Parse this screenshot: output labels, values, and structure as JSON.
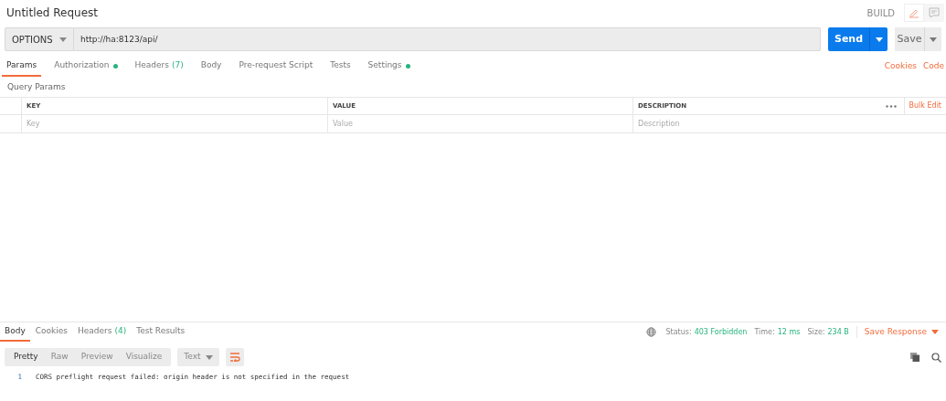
{
  "title": "Untitled Request",
  "mode": "BUILD",
  "request": {
    "method": "OPTIONS",
    "url": "http://ha:8123/api/",
    "send": "Send",
    "save": "Save"
  },
  "request_tabs": [
    {
      "label": "Params",
      "dot": false,
      "selected": true
    },
    {
      "label": "Authorization",
      "dot": true,
      "selected": false
    },
    {
      "label": "Headers",
      "count": "(7)",
      "dot": false,
      "selected": false
    },
    {
      "label": "Body",
      "dot": false,
      "selected": false
    },
    {
      "label": "Pre-request Script",
      "dot": false,
      "selected": false
    },
    {
      "label": "Tests",
      "dot": false,
      "selected": false
    },
    {
      "label": "Settings",
      "dot": true,
      "selected": false
    }
  ],
  "links": [
    "Cookies",
    "Code"
  ],
  "section_title": "Query Params",
  "params_table": {
    "columns": [
      "KEY",
      "VALUE",
      "DESCRIPTION"
    ],
    "bulk_edit": "Bulk Edit",
    "placeholders": [
      "Key",
      "Value",
      "Description"
    ]
  },
  "response_tabs": [
    {
      "label": "Body",
      "selected": true
    },
    {
      "label": "Cookies",
      "selected": false
    },
    {
      "label": "Headers",
      "count": "(4)",
      "selected": false
    },
    {
      "label": "Test Results",
      "selected": false
    }
  ],
  "response_meta": [
    {
      "label": "Status:",
      "value": "403 Forbidden"
    },
    {
      "label": "Time:",
      "value": "12 ms"
    },
    {
      "label": "Size:",
      "value": "234 B"
    }
  ],
  "save_response": "Save Response",
  "view_modes": [
    {
      "label": "Pretty",
      "selected": true
    },
    {
      "label": "Raw",
      "selected": false
    },
    {
      "label": "Preview",
      "selected": false
    },
    {
      "label": "Visualize",
      "selected": false
    }
  ],
  "format": "Text",
  "lines": [
    {
      "number": "1",
      "text": "CORS preflight request failed: origin header is not specified in the request"
    }
  ]
}
